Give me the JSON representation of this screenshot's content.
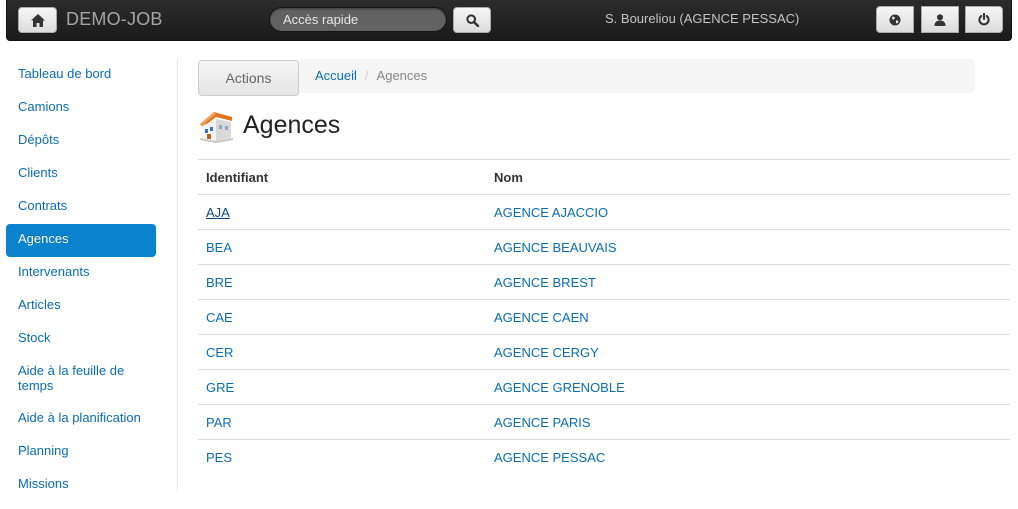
{
  "navbar": {
    "brand": "DEMO-JOB",
    "search_placeholder": "Accès rapide",
    "user_label": "S. Boureliou (AGENCE PESSAC)",
    "icons": {
      "home": "home-icon",
      "search": "search-icon",
      "globe": "globe-icon",
      "user": "user-icon",
      "power": "power-icon"
    }
  },
  "sidebar": {
    "items": [
      {
        "label": "Tableau de bord"
      },
      {
        "label": "Camions"
      },
      {
        "label": "Dépôts"
      },
      {
        "label": "Clients"
      },
      {
        "label": "Contrats"
      },
      {
        "label": "Agences",
        "active": true
      },
      {
        "label": "Intervenants"
      },
      {
        "label": "Articles"
      },
      {
        "label": "Stock"
      },
      {
        "label": "Aide à la feuille de temps"
      },
      {
        "label": "Aide à la planification"
      },
      {
        "label": "Planning"
      },
      {
        "label": "Missions"
      }
    ]
  },
  "actions_label": "Actions",
  "breadcrumb": {
    "home": "Accueil",
    "separator": "/",
    "current": "Agences"
  },
  "page": {
    "title": "Agences",
    "icon": "building-icon"
  },
  "table": {
    "headers": {
      "id": "Identifiant",
      "name": "Nom"
    },
    "rows": [
      {
        "id": "AJA",
        "name": "AGENCE AJACCIO"
      },
      {
        "id": "BEA",
        "name": "AGENCE BEAUVAIS"
      },
      {
        "id": "BRE",
        "name": "AGENCE BREST"
      },
      {
        "id": "CAE",
        "name": "AGENCE CAEN"
      },
      {
        "id": "CER",
        "name": "AGENCE CERGY"
      },
      {
        "id": "GRE",
        "name": "AGENCE GRENOBLE"
      },
      {
        "id": "PAR",
        "name": "AGENCE PARIS"
      },
      {
        "id": "PES",
        "name": "AGENCE PESSAC"
      }
    ]
  },
  "colors": {
    "link": "#0a6db0",
    "active_bg": "#0a83cf",
    "navbar_bg": "#222222"
  }
}
